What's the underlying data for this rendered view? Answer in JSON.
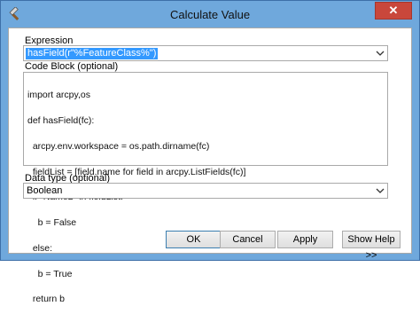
{
  "window": {
    "title": "Calculate Value",
    "close_label": "✕"
  },
  "expression": {
    "label": "Expression",
    "value": "hasField(r\"%FeatureClass%\")"
  },
  "code_block": {
    "label": "Code Block (optional)",
    "lines": [
      "import arcpy,os",
      "def hasField(fc):",
      "  arcpy.env.workspace = os.path.dirname(fc)",
      "  fieldList = [field.name for field in arcpy.ListFields(fc)]",
      "  if \"Name2\" in fieldList:",
      "    b = False",
      "  else:",
      "    b = True",
      "  return b"
    ]
  },
  "data_type": {
    "label": "Data type (optional)",
    "value": "Boolean"
  },
  "buttons": {
    "ok": "OK",
    "cancel": "Cancel",
    "apply": "Apply",
    "show_help": "Show Help >>"
  }
}
